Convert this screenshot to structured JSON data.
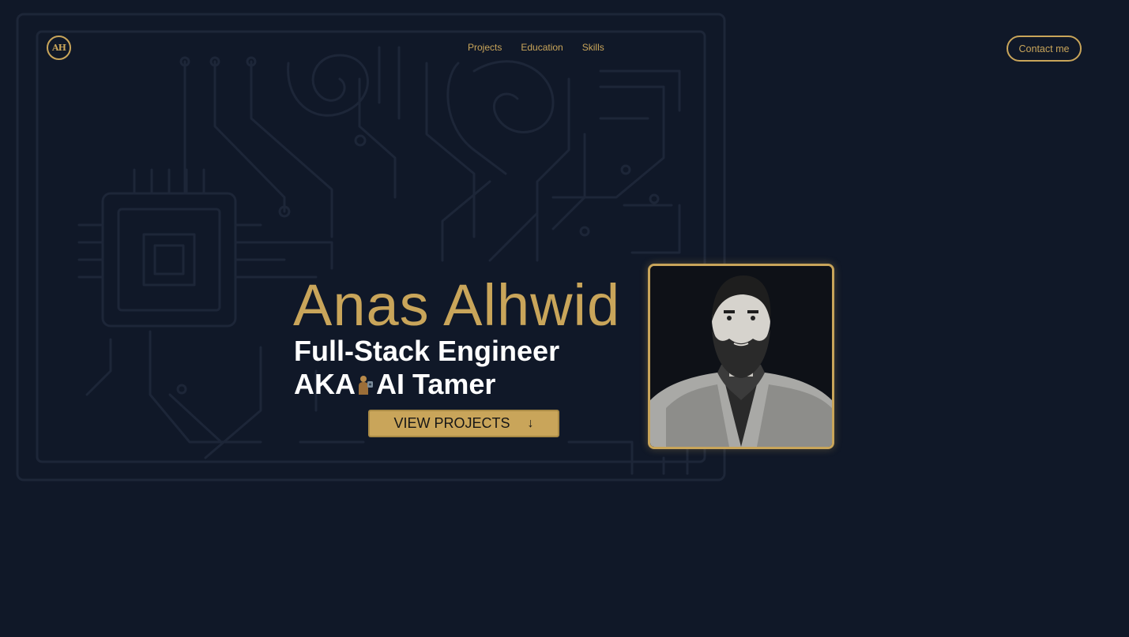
{
  "logo": {
    "text": "AH",
    "icon": "monogram-logo"
  },
  "nav": {
    "items": [
      "Projects",
      "Education",
      "Skills"
    ]
  },
  "contact": {
    "label": "Contact me"
  },
  "hero": {
    "name": "Anas Alhwid",
    "role": "Full-Stack Engineer",
    "aka_prefix": "AKA",
    "aka_suffix": "AI Tamer",
    "aka_icon": "tamer-figure-icon",
    "cta_label": "VIEW PROJECTS",
    "cta_icon": "arrow-down-icon"
  },
  "photo": {
    "icon": "portrait-photo"
  },
  "colors": {
    "background": "#101828",
    "accent": "#c9a55a",
    "text": "#ffffff",
    "circuit": "#1b2335"
  }
}
